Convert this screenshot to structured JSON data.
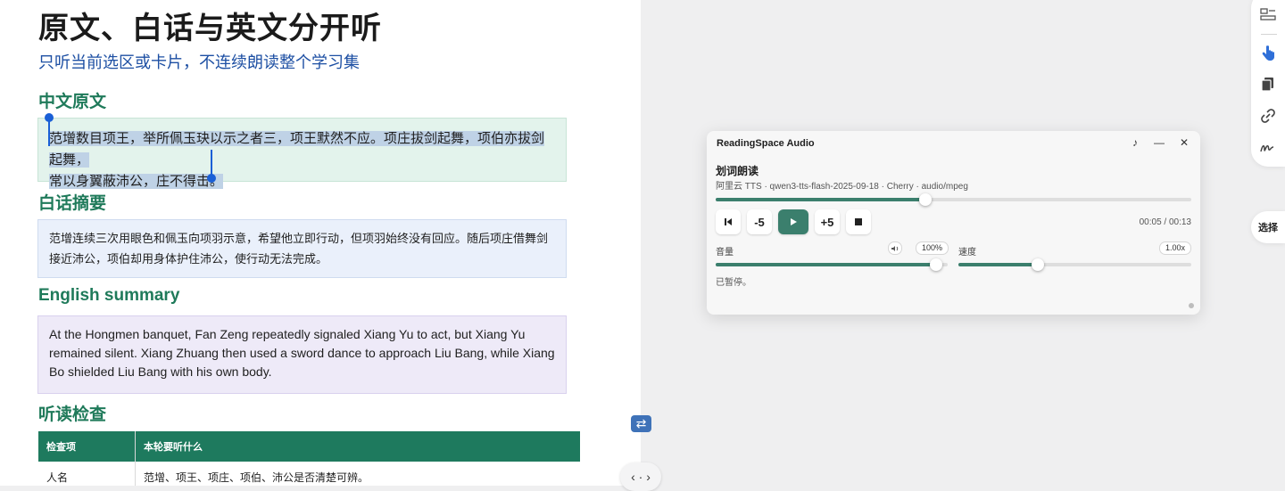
{
  "document": {
    "title": "原文、白话与英文分开听",
    "subtitle": "只听当前选区或卡片，不连续朗读整个学习集",
    "sections": {
      "original": {
        "heading": "中文原文",
        "text_line1": "范增数目项王，举所佩玉玦以示之者三，项王默然不应。项庄拔剑起舞，项伯亦拔剑起舞，",
        "text_line2": "常以身翼蔽沛公，庄不得击。"
      },
      "plain": {
        "heading": "白话摘要",
        "text": "范增连续三次用眼色和佩玉向项羽示意，希望他立即行动，但项羽始终没有回应。随后项庄借舞剑接近沛公，项伯却用身体护住沛公，使行动无法完成。"
      },
      "english": {
        "heading": "English summary",
        "text": "At the Hongmen banquet, Fan Zeng repeatedly signaled Xiang Yu to act, but Xiang Yu remained silent. Xiang Zhuang then used a sword dance to approach Liu Bang, while Xiang Bo shielded Liu Bang with his own body."
      },
      "check": {
        "heading": "听读检查",
        "columns": [
          "检查项",
          "本轮要听什么"
        ],
        "rows": [
          [
            "人名",
            "范增、项王、项庄、项伯、沛公是否清楚可辨。"
          ]
        ]
      }
    }
  },
  "divider": {
    "swap_icon": "swap-arrows-icon",
    "nav_label": "‹ · ›"
  },
  "rail": {
    "icons": [
      "layout-icon",
      "pointer-hand-icon",
      "copy-icon",
      "link-icon",
      "signature-icon"
    ],
    "select_label": "选择"
  },
  "audio_panel": {
    "app_title": "ReadingSpace Audio",
    "window_controls": [
      "♪",
      "—",
      "✕"
    ],
    "mode_heading": "划词朗读",
    "meta": "阿里云 TTS · qwen3-tts-flash-2025-09-18 · Cherry · audio/mpeg",
    "progress_fraction": 0.44,
    "buttons": {
      "prev": "⏮",
      "back": "-5",
      "play": "▶",
      "forward": "+5",
      "stop": "■"
    },
    "time": "00:05 / 00:13",
    "volume": {
      "label": "音量",
      "icon": "speaker-icon",
      "value_text": "100%",
      "fraction": 0.95
    },
    "speed": {
      "label": "速度",
      "value_text": "1.00x",
      "fraction": 0.34
    },
    "status": "已暂停。",
    "colors": {
      "accent": "#3b7f6d",
      "heading_green": "#1f7a5a",
      "subtitle_blue": "#1d4fa3",
      "selection_cursor": "#1a5fd6"
    }
  }
}
